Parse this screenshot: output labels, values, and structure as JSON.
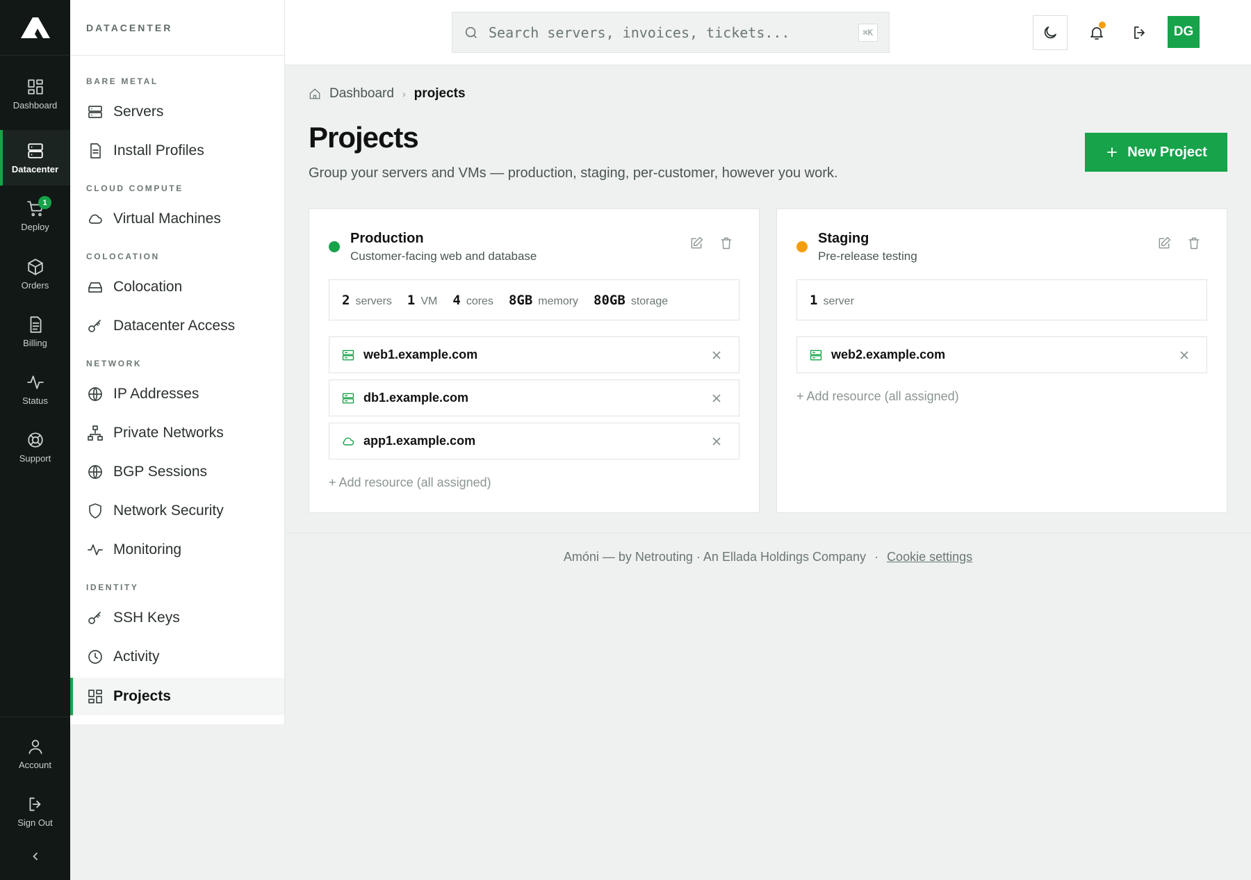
{
  "rail": {
    "items": [
      {
        "label": "Dashboard",
        "icon": "grid-icon"
      },
      {
        "label": "Datacenter",
        "icon": "server-icon",
        "active": true
      },
      {
        "label": "Deploy",
        "icon": "cart-icon",
        "badge": "1"
      },
      {
        "label": "Orders",
        "icon": "box-icon"
      },
      {
        "label": "Billing",
        "icon": "document-icon"
      },
      {
        "label": "Status",
        "icon": "pulse-icon"
      },
      {
        "label": "Support",
        "icon": "lifebuoy-icon"
      }
    ],
    "bottom": [
      {
        "label": "Account",
        "icon": "user-icon"
      },
      {
        "label": "Sign Out",
        "icon": "sign-out-icon"
      }
    ]
  },
  "subnav": {
    "title": "DATACENTER",
    "sections": [
      {
        "label": "BARE METAL",
        "items": [
          "Servers",
          "Install Profiles"
        ]
      },
      {
        "label": "CLOUD COMPUTE",
        "items": [
          "Virtual Machines"
        ]
      },
      {
        "label": "COLOCATION",
        "items": [
          "Colocation",
          "Datacenter Access"
        ]
      },
      {
        "label": "NETWORK",
        "items": [
          "IP Addresses",
          "Private Networks",
          "BGP Sessions",
          "Network Security",
          "Monitoring"
        ]
      },
      {
        "label": "IDENTITY",
        "items": [
          "SSH Keys",
          "Activity",
          "Projects"
        ]
      }
    ],
    "active": "Projects"
  },
  "topbar": {
    "search_placeholder": "Search servers, invoices, tickets...",
    "shortcut": "⌘K",
    "avatar_initials": "DG"
  },
  "breadcrumb": {
    "home": "Dashboard",
    "current": "projects"
  },
  "page": {
    "title": "Projects",
    "subtitle": "Group your servers and VMs — production, staging, per-customer, however you work.",
    "new_button": "New Project"
  },
  "projects": [
    {
      "name": "Production",
      "description": "Customer-facing web and database",
      "status_color": "#16a34a",
      "stats": [
        {
          "value": "2",
          "unit": "servers"
        },
        {
          "value": "1",
          "unit": "VM"
        },
        {
          "value": "4",
          "unit": "cores"
        },
        {
          "value": "8GB",
          "unit": "memory"
        },
        {
          "value": "80GB",
          "unit": "storage"
        }
      ],
      "resources": [
        {
          "name": "web1.example.com",
          "type": "server"
        },
        {
          "name": "db1.example.com",
          "type": "server"
        },
        {
          "name": "app1.example.com",
          "type": "vm"
        }
      ],
      "add_label": "+ Add resource (all assigned)"
    },
    {
      "name": "Staging",
      "description": "Pre-release testing",
      "status_color": "#f59e0b",
      "stats": [
        {
          "value": "1",
          "unit": "server"
        }
      ],
      "resources": [
        {
          "name": "web2.example.com",
          "type": "server"
        }
      ],
      "add_label": "+ Add resource (all assigned)"
    }
  ],
  "footer": {
    "text": "Amóni — by Netrouting · An Ellada Holdings Company",
    "separator": "·",
    "cookie": "Cookie settings"
  },
  "colors": {
    "accent": "#16a34a",
    "rail_bg": "#111816",
    "warning": "#f59e0b"
  }
}
